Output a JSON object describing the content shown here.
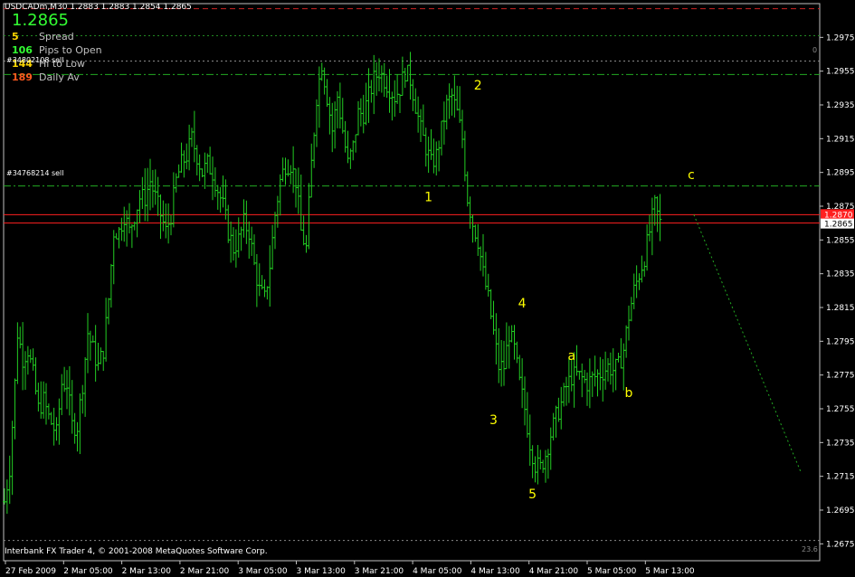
{
  "header": {
    "symbol_text": "USDCADm,M30",
    "ohlc_text": "1.2883 1.2883 1.2854 1.2865",
    "big_price": "1.2865"
  },
  "stats": [
    {
      "value": "5",
      "label": "Spread",
      "color": "#ffd700"
    },
    {
      "value": "106",
      "label": "Pips to Open",
      "color": "#33ff33"
    },
    {
      "value": "144",
      "label": "Hi to Low",
      "color": "#ffd700"
    },
    {
      "value": "189",
      "label": "Daily Av",
      "color": "#ff5a1e"
    }
  ],
  "orders": [
    {
      "label": "#34802108 sell"
    },
    {
      "label": "#34768214 sell"
    }
  ],
  "footer_text": "Interbank FX Trader 4, © 2001-2008 MetaQuotes Software Corp.",
  "corner_text_top": "0",
  "corner_text_bottom": "23.6",
  "chart_data": {
    "type": "bar",
    "timeframe": "M30",
    "ylim": [
      1.2665,
      1.2995
    ],
    "y_ticks": [
      "1.2975",
      "1.2955",
      "1.2935",
      "1.2915",
      "1.2895",
      "1.2875",
      "1.2855",
      "1.2835",
      "1.2815",
      "1.2795",
      "1.2775",
      "1.2755",
      "1.2735",
      "1.2715",
      "1.2695",
      "1.2675"
    ],
    "x_ticks": [
      "27 Feb 2009",
      "2 Mar 05:00",
      "2 Mar 13:00",
      "2 Mar 21:00",
      "3 Mar 05:00",
      "3 Mar 13:00",
      "3 Mar 21:00",
      "4 Mar 05:00",
      "4 Mar 13:00",
      "4 Mar 21:00",
      "5 Mar 05:00",
      "5 Mar 13:00"
    ],
    "current_price": "1.2865",
    "ask_price": "1.2870",
    "colors": {
      "bars": "#22cc22",
      "wave_labels": "#ffff00",
      "price_lines": "#ff2020",
      "order_lines": "#22aa22",
      "trend": "#22aa22"
    },
    "horizontal_lines": [
      {
        "price": 1.2992,
        "style": "dash",
        "color": "#cc2222"
      },
      {
        "price": 1.2976,
        "style": "dot",
        "color": "#228822"
      },
      {
        "price": 1.2961,
        "style": "dot",
        "color": "#888888"
      },
      {
        "price": 1.2953,
        "style": "dashdot",
        "color": "#22aa22"
      },
      {
        "price": 1.2887,
        "style": "dashdot",
        "color": "#22aa22"
      },
      {
        "price": 1.287,
        "style": "solid",
        "color": "#ff2020"
      },
      {
        "price": 1.2865,
        "style": "solid",
        "color": "#ff2020"
      },
      {
        "price": 1.2677,
        "style": "dot",
        "color": "#888888"
      }
    ],
    "wave_labels": [
      {
        "text": "1",
        "t": 163,
        "price": 1.2878
      },
      {
        "text": "2",
        "t": 182,
        "price": 1.2944
      },
      {
        "text": "3",
        "t": 188,
        "price": 1.2746
      },
      {
        "text": "4",
        "t": 199,
        "price": 1.2815
      },
      {
        "text": "5",
        "t": 203,
        "price": 1.2702
      },
      {
        "text": "a",
        "t": 218,
        "price": 1.2784
      },
      {
        "text": "b",
        "t": 240,
        "price": 1.2762
      },
      {
        "text": "c",
        "t": 264,
        "price": 1.2891
      }
    ],
    "trend_line": {
      "from": {
        "t": 265,
        "price": 1.287
      },
      "to": {
        "t": 306,
        "price": 1.2718
      }
    },
    "series_close": [
      [
        0,
        1.27
      ],
      [
        2,
        1.272
      ],
      [
        4,
        1.277
      ],
      [
        5,
        1.28
      ],
      [
        7,
        1.2785
      ],
      [
        9,
        1.279
      ],
      [
        11,
        1.2775
      ],
      [
        13,
        1.2755
      ],
      [
        15,
        1.276
      ],
      [
        17,
        1.275
      ],
      [
        20,
        1.274
      ],
      [
        22,
        1.277
      ],
      [
        24,
        1.277
      ],
      [
        26,
        1.2745
      ],
      [
        28,
        1.2745
      ],
      [
        30,
        1.277
      ],
      [
        32,
        1.28
      ],
      [
        34,
        1.279
      ],
      [
        36,
        1.278
      ],
      [
        38,
        1.279
      ],
      [
        40,
        1.282
      ],
      [
        42,
        1.286
      ],
      [
        44,
        1.286
      ],
      [
        46,
        1.287
      ],
      [
        48,
        1.286
      ],
      [
        50,
        1.287
      ],
      [
        52,
        1.288
      ],
      [
        54,
        1.288
      ],
      [
        56,
        1.289
      ],
      [
        58,
        1.288
      ],
      [
        60,
        1.287
      ],
      [
        62,
        1.286
      ],
      [
        64,
        1.287
      ],
      [
        66,
        1.289
      ],
      [
        68,
        1.29
      ],
      [
        70,
        1.2905
      ],
      [
        72,
        1.2915
      ],
      [
        74,
        1.2905
      ],
      [
        76,
        1.2895
      ],
      [
        78,
        1.29
      ],
      [
        80,
        1.2895
      ],
      [
        82,
        1.2885
      ],
      [
        84,
        1.2875
      ],
      [
        86,
        1.286
      ],
      [
        88,
        1.285
      ],
      [
        90,
        1.2855
      ],
      [
        92,
        1.2865
      ],
      [
        94,
        1.286
      ],
      [
        96,
        1.284
      ],
      [
        98,
        1.2825
      ],
      [
        100,
        1.282
      ],
      [
        102,
        1.284
      ],
      [
        104,
        1.287
      ],
      [
        106,
        1.289
      ],
      [
        108,
        1.29
      ],
      [
        110,
        1.29
      ],
      [
        112,
        1.289
      ],
      [
        114,
        1.286
      ],
      [
        116,
        1.285
      ],
      [
        118,
        1.29
      ],
      [
        120,
        1.294
      ],
      [
        122,
        1.296
      ],
      [
        124,
        1.294
      ],
      [
        126,
        1.292
      ],
      [
        128,
        1.294
      ],
      [
        130,
        1.292
      ],
      [
        132,
        1.29
      ],
      [
        134,
        1.291
      ],
      [
        136,
        1.293
      ],
      [
        138,
        1.293
      ],
      [
        140,
        1.294
      ],
      [
        142,
        1.295
      ],
      [
        144,
        1.2955
      ],
      [
        146,
        1.295
      ],
      [
        148,
        1.2945
      ],
      [
        150,
        1.294
      ],
      [
        152,
        1.2945
      ],
      [
        154,
        1.2955
      ],
      [
        156,
        1.295
      ],
      [
        158,
        1.2935
      ],
      [
        160,
        1.292
      ],
      [
        162,
        1.291
      ],
      [
        164,
        1.29
      ],
      [
        166,
        1.2905
      ],
      [
        168,
        1.292
      ],
      [
        170,
        1.2935
      ],
      [
        172,
        1.294
      ],
      [
        174,
        1.293
      ],
      [
        176,
        1.2915
      ],
      [
        178,
        1.288
      ],
      [
        180,
        1.2865
      ],
      [
        182,
        1.2855
      ],
      [
        184,
        1.2835
      ],
      [
        186,
        1.282
      ],
      [
        188,
        1.28
      ],
      [
        190,
        1.278
      ],
      [
        192,
        1.278
      ],
      [
        194,
        1.28
      ],
      [
        196,
        1.279
      ],
      [
        198,
        1.277
      ],
      [
        200,
        1.2755
      ],
      [
        202,
        1.2735
      ],
      [
        204,
        1.2722
      ],
      [
        206,
        1.272
      ],
      [
        208,
        1.2728
      ],
      [
        210,
        1.274
      ],
      [
        212,
        1.275
      ],
      [
        214,
        1.2758
      ],
      [
        216,
        1.2768
      ],
      [
        218,
        1.2774
      ],
      [
        220,
        1.2775
      ],
      [
        222,
        1.2773
      ],
      [
        224,
        1.277
      ],
      [
        226,
        1.2773
      ],
      [
        228,
        1.2775
      ],
      [
        230,
        1.2777
      ],
      [
        232,
        1.278
      ],
      [
        234,
        1.2778
      ],
      [
        236,
        1.278
      ],
      [
        238,
        1.279
      ],
      [
        240,
        1.281
      ],
      [
        242,
        1.2825
      ],
      [
        244,
        1.2835
      ],
      [
        246,
        1.2845
      ],
      [
        248,
        1.286
      ],
      [
        250,
        1.2875
      ],
      [
        252,
        1.2865
      ]
    ]
  }
}
